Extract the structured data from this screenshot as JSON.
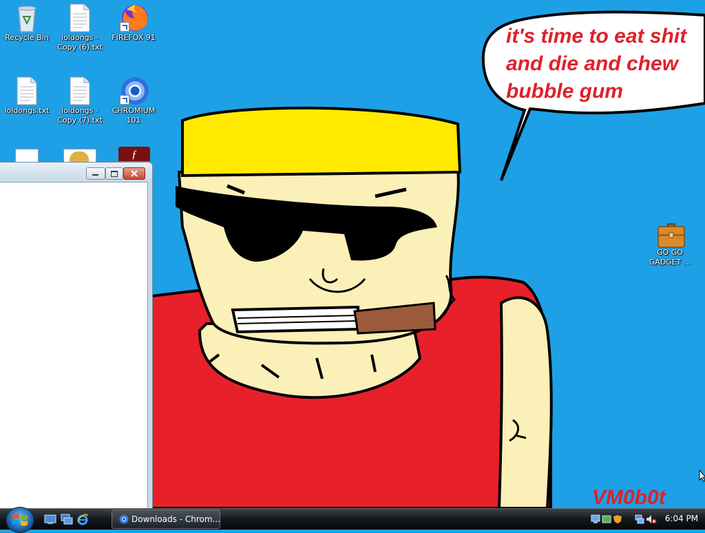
{
  "desktop": {
    "icons": [
      {
        "label": "Recycle Bin",
        "icon": "recycle-bin-icon"
      },
      {
        "label": "loldongs - Copy (6).txt",
        "icon": "text-file-icon"
      },
      {
        "label": "FIREFOX 91",
        "icon": "firefox-icon"
      },
      {
        "label": "loldongs.txt",
        "icon": "text-file-icon"
      },
      {
        "label": "loldongs - Copy (7).txt",
        "icon": "text-file-icon"
      },
      {
        "label": "CHROMIUM 101",
        "icon": "chromium-icon"
      },
      {
        "label": "GO GO GADGET ...",
        "icon": "briefcase-icon"
      }
    ]
  },
  "wallpaper": {
    "speech_lines": [
      "it's time to eat shit",
      "and die and chew",
      "bubble gum"
    ],
    "signature": "VM0b0t",
    "colors": {
      "sky": "#1ea0e6",
      "text": "#e0202a",
      "shirt": "#e8202a",
      "hair": "#ffea00",
      "skin": "#fbf0b8"
    }
  },
  "window": {
    "title": ""
  },
  "taskbar": {
    "start_icon": "windows-logo-icon",
    "quick_launch": [
      "show-desktop-icon",
      "switch-windows-icon",
      "internet-explorer-icon"
    ],
    "tasks": [
      {
        "label": "Downloads - Chrom...",
        "icon": "chrome-icon"
      }
    ],
    "clock": "6:04 PM",
    "tray_icons": [
      "network-icon",
      "windows-defender-icon",
      "speaker-muted-icon"
    ]
  }
}
